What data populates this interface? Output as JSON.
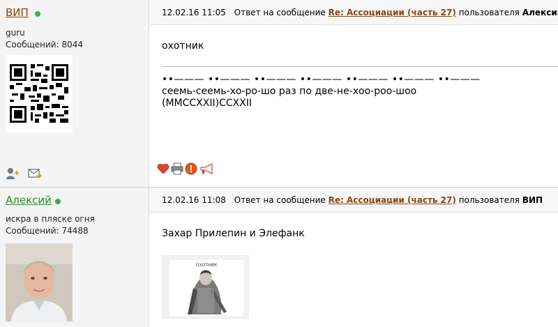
{
  "posts": [
    {
      "author": "ВИП",
      "rank": "guru",
      "count_label": "Сообщений: 8044",
      "datetime": "12.02.16 11:05",
      "reply_prefix": "Ответ на сообщение",
      "reply_topic": "Re: Ассоциации (часть 27)",
      "user_prefix": "пользователя",
      "reply_user": "Алексий",
      "message": "охотник",
      "signature_line1": "••——— ••——— ••——— ••——— ••——— ••——— ••———",
      "signature_line2": "сеемь-сеемь-хо-ро-шо раз по две-не-хоо-роо-шоо",
      "signature_line3": "(MMCCXXII)CCXXII",
      "avatar_icon": "qr-code-icon",
      "tool_icons": [
        "add-friend-icon",
        "send-message-icon"
      ],
      "action_icons": [
        "heart-icon",
        "print-icon",
        "report-icon",
        "announce-icon"
      ]
    },
    {
      "author": "Алексий",
      "rank": "искра в пляске огня",
      "count_label": "Сообщений: 74488",
      "datetime": "12.02.16 11:08",
      "reply_prefix": "Ответ на сообщение",
      "reply_topic": "Re: Ассоциации (часть 27)",
      "user_prefix": "пользователя",
      "reply_user": "ВИП",
      "message": "Захар Прилепин и Элефанк",
      "attachment_caption": "ОХОТНИК",
      "avatar_icon": "user-photo"
    }
  ],
  "colors": {
    "author1": "#8b4513",
    "author2": "#2e8b2e",
    "online": "#37b24d",
    "link": "#8b4513"
  }
}
